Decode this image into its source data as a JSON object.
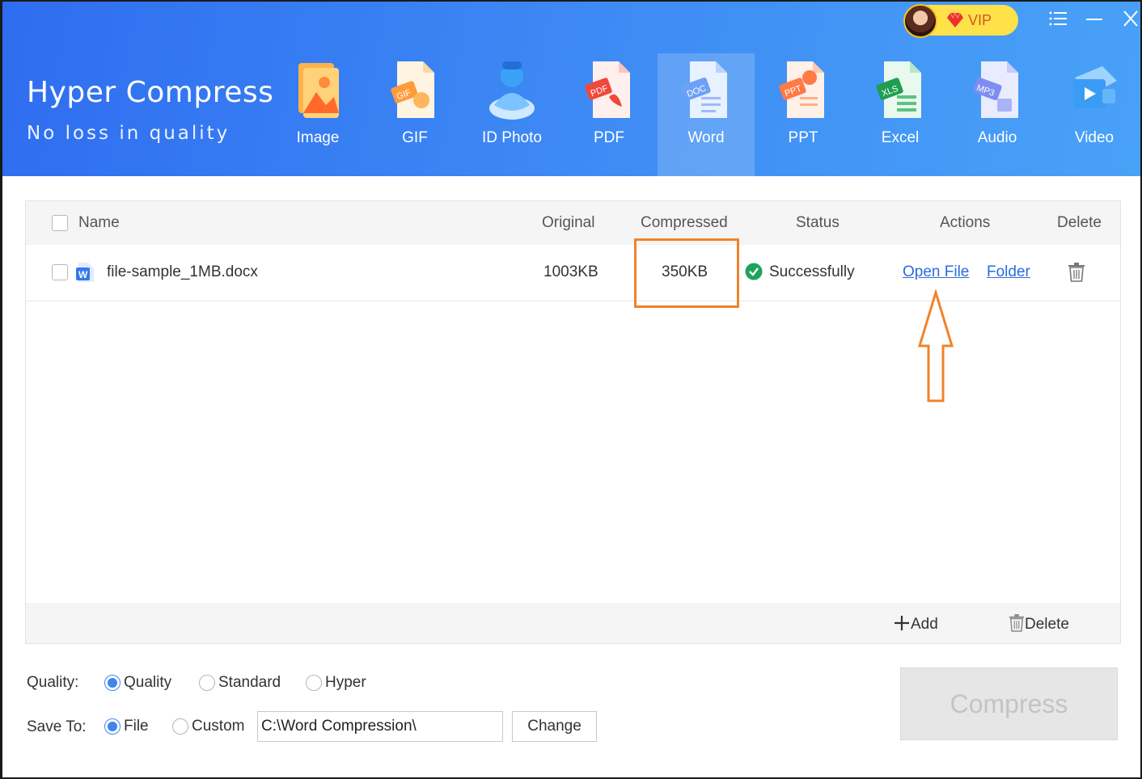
{
  "app": {
    "title": "Hyper Compress",
    "subtitle": "No loss in quality",
    "vip_label": "VIP"
  },
  "toolbar": {
    "tools": [
      {
        "label": "Image",
        "icon": "image-icon"
      },
      {
        "label": "GIF",
        "icon": "gif-icon"
      },
      {
        "label": "ID Photo",
        "icon": "id-photo-icon"
      },
      {
        "label": "PDF",
        "icon": "pdf-icon"
      },
      {
        "label": "Word",
        "icon": "word-icon",
        "active": true
      },
      {
        "label": "PPT",
        "icon": "ppt-icon"
      },
      {
        "label": "Excel",
        "icon": "excel-icon"
      },
      {
        "label": "Audio",
        "icon": "audio-icon"
      },
      {
        "label": "Video",
        "icon": "video-icon"
      }
    ],
    "badges": {
      "gif": "GIF",
      "pdf": "PDF",
      "word": "DOC",
      "ppt": "PPT",
      "excel": "XLS",
      "audio": "MP3"
    }
  },
  "table": {
    "headers": {
      "name": "Name",
      "original": "Original",
      "compressed": "Compressed",
      "status": "Status",
      "actions": "Actions",
      "delete": "Delete"
    },
    "rows": [
      {
        "name": "file-sample_1MB.docx",
        "original": "1003KB",
        "compressed": "350KB",
        "status": "Successfully",
        "open_file": "Open File",
        "folder": "Folder",
        "file_icon_letter": "W"
      }
    ],
    "footer": {
      "add_label": "Add",
      "delete_label": "Delete"
    }
  },
  "options": {
    "quality_label": "Quality:",
    "quality_choices": [
      "Quality",
      "Standard",
      "Hyper"
    ],
    "quality_selected": "Quality",
    "save_label": "Save To:",
    "save_choices": [
      "File",
      "Custom"
    ],
    "save_selected": "File",
    "path_value": "C:\\Word Compression\\",
    "change_label": "Change",
    "compress_label": "Compress"
  },
  "colors": {
    "header_start": "#2f6df0",
    "header_end": "#48a2f6",
    "highlight": "#f0832a",
    "link": "#2a6ddb",
    "radio_on": "#3d86ee",
    "success": "#1ea35a",
    "vip": "#ffe14a"
  }
}
